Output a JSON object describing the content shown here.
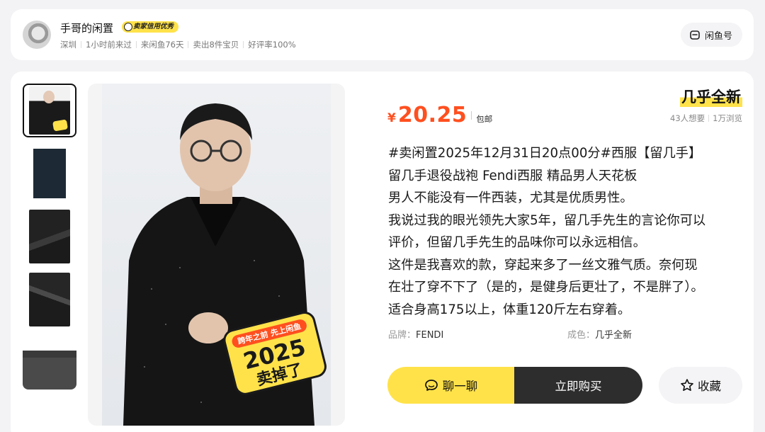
{
  "seller": {
    "name": "手哥的闲置",
    "badge": "卖家信用优秀",
    "meta": [
      "深圳",
      "1小时前来过",
      "来闲鱼76天",
      "卖出8件宝贝",
      "好评率100%"
    ],
    "account_button": "闲鱼号"
  },
  "product": {
    "condition": "几乎全新",
    "stats": [
      "43人想要",
      "1万浏览"
    ],
    "price": {
      "symbol": "¥",
      "value": "20.25",
      "shipping": "包邮"
    },
    "description_lines": [
      "#卖闲置2025年12月31日20点00分#西服【留几手】",
      "留几手退役战袍 Fendi西服 精品男人天花板",
      "男人不能没有一件西装，尤其是优质男性。",
      "我说过我的眼光领先大家5年，留几手先生的言论你可以",
      "评价，但留几手先生的品味你可以永远相信。",
      "这件是我喜欢的款，穿起来多了一丝文雅气质。奈何现",
      "在壮了穿不下了（是的，是健身后更壮了，不是胖了）。",
      "适合身高175以上，体重120斤左右穿着。"
    ],
    "attributes": [
      {
        "key": "品牌：",
        "value": "FENDI"
      },
      {
        "key": "成色：",
        "value": "几乎全新"
      }
    ],
    "promo_sticker": {
      "top": "跨年之前 先上闲鱼",
      "year": "2025",
      "slogan": "卖掉了"
    }
  },
  "actions": {
    "chat": "聊一聊",
    "buy": "立即购买",
    "favorite": "收藏"
  },
  "colors": {
    "accent_yellow": "#ffe24a",
    "price_orange": "#ff4f1f",
    "buy_dark": "#2d2d2d"
  }
}
